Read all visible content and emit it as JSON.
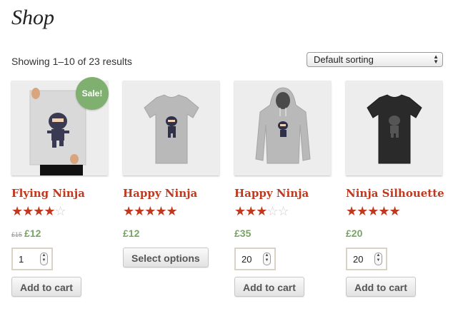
{
  "page": {
    "title": "Shop",
    "result_count": "Showing 1–10 of 23 results"
  },
  "sorting": {
    "selected": "Default sorting",
    "arrows_icon": "select-arrows-icon"
  },
  "colors": {
    "product_title": "#c0381d",
    "price": "#77a464",
    "sale_badge": "#7fb070",
    "star_on": "#c0381d",
    "star_off": "#cfcfcf"
  },
  "products": [
    {
      "name": "Flying Ninja",
      "rating_stars": 4,
      "old_price": "£15",
      "price": "£12",
      "sale_badge": "Sale!",
      "quantity": "1",
      "button": "Add to cart",
      "image": "ninja-poster"
    },
    {
      "name": "Happy Ninja",
      "rating_stars": 5,
      "price": "£12",
      "button": "Select options",
      "image": "grey-tshirt"
    },
    {
      "name": "Happy Ninja",
      "rating_stars": 3,
      "price": "£35",
      "quantity": "20",
      "button": "Add to cart",
      "image": "grey-hoodie"
    },
    {
      "name": "Ninja Silhouette",
      "rating_stars": 5,
      "price": "£20",
      "quantity": "20",
      "button": "Add to cart",
      "image": "black-tshirt"
    }
  ]
}
